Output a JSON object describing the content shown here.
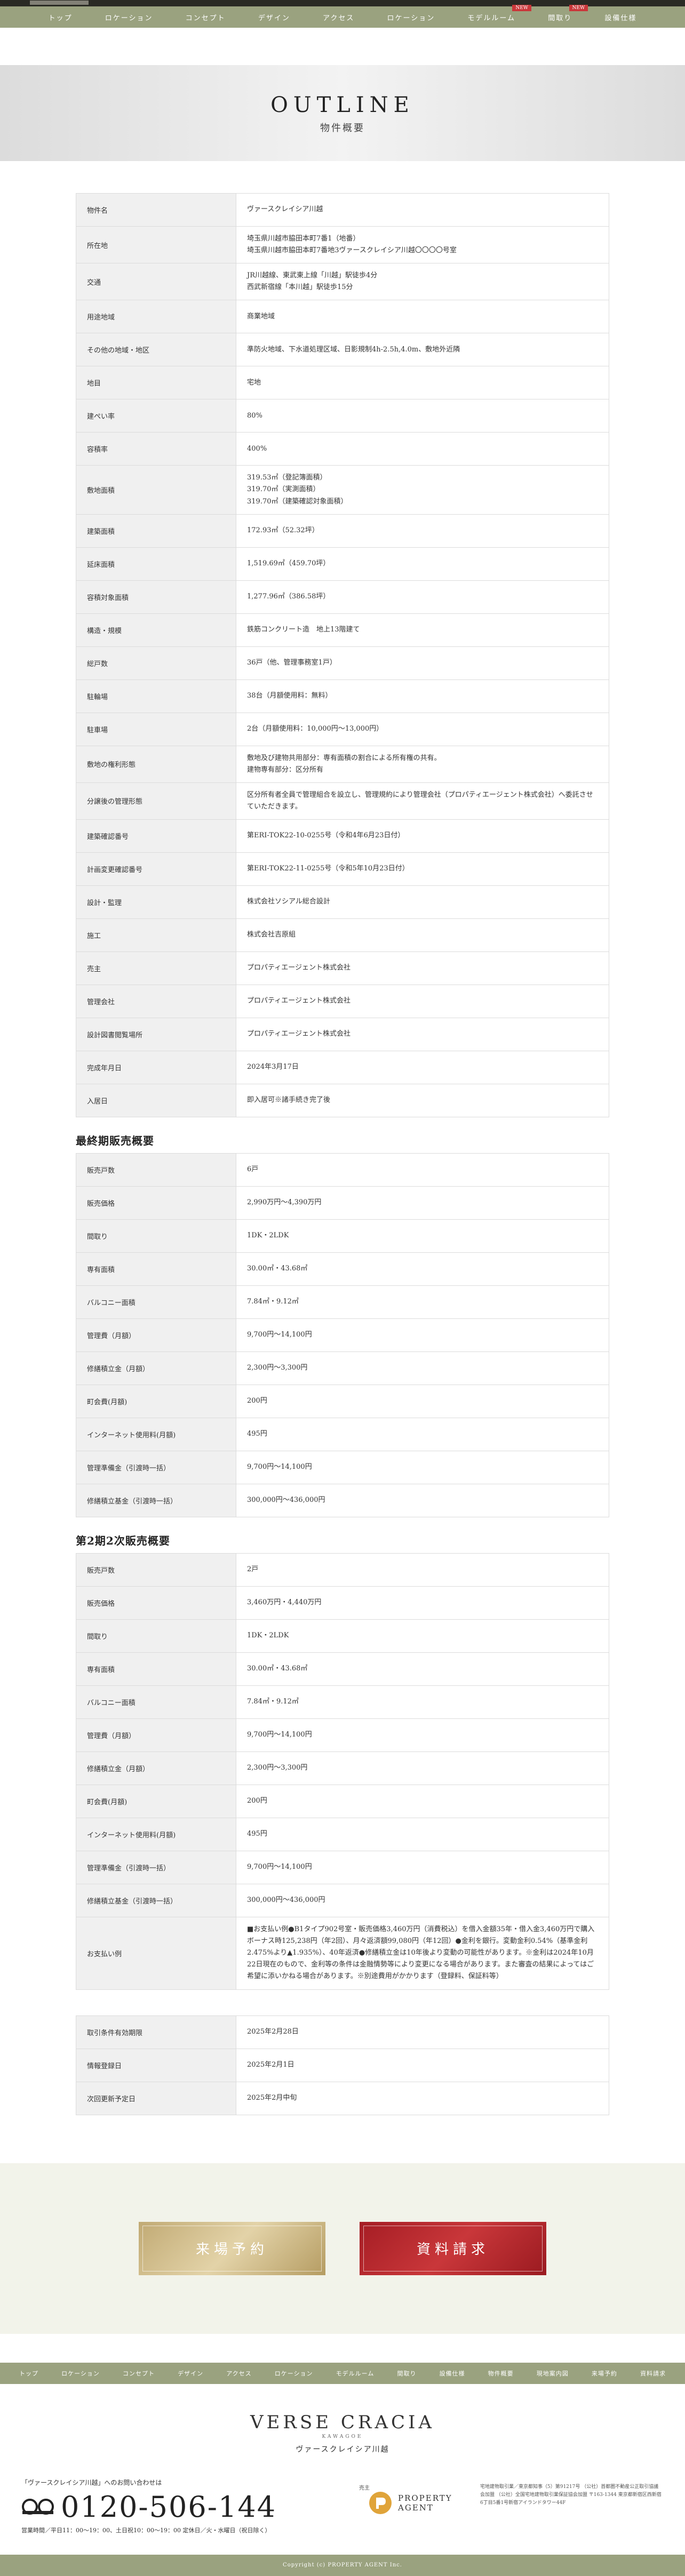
{
  "nav": {
    "items": [
      {
        "label": "トップ",
        "badge": ""
      },
      {
        "label": "ロケーション",
        "badge": ""
      },
      {
        "label": "コンセプト",
        "badge": ""
      },
      {
        "label": "デザイン",
        "badge": ""
      },
      {
        "label": "アクセス",
        "badge": ""
      },
      {
        "label": "ロケーション",
        "badge": ""
      },
      {
        "label": "モデルルーム",
        "badge": "NEW"
      },
      {
        "label": "間取り",
        "badge": "NEW"
      },
      {
        "label": "設備仕様",
        "badge": ""
      }
    ]
  },
  "hero": {
    "title": "OUTLINE",
    "subtitle": "物件概要"
  },
  "outline_rows": [
    {
      "label": "物件名",
      "lines": [
        "ヴァースクレイシア川越"
      ]
    },
    {
      "label": "所在地",
      "lines": [
        "埼玉県川越市脇田本町7番1（地番）",
        "埼玉県川越市脇田本町7番地3ヴァースクレイシア川越〇〇〇〇号室"
      ]
    },
    {
      "label": "交通",
      "lines": [
        "JR川越線、東武東上線「川越」駅徒歩4分",
        "西武新宿線「本川越」駅徒歩15分"
      ]
    },
    {
      "label": "用途地域",
      "lines": [
        "商業地域"
      ]
    },
    {
      "label": "その他の地域・地区",
      "lines": [
        "準防火地域、下水道処理区域、日影規制4h-2.5h,4.0m、敷地外近隣"
      ]
    },
    {
      "label": "地目",
      "lines": [
        "宅地"
      ]
    },
    {
      "label": "建ぺい率",
      "lines": [
        "80%"
      ]
    },
    {
      "label": "容積率",
      "lines": [
        "400%"
      ]
    },
    {
      "label": "敷地面積",
      "lines": [
        "319.53㎡（登記簿面積）",
        "319.70㎡（実測面積）",
        "319.70㎡（建築確認対象面積）"
      ]
    },
    {
      "label": "建築面積",
      "lines": [
        "172.93㎡（52.32坪）"
      ]
    },
    {
      "label": "延床面積",
      "lines": [
        "1,519.69㎡（459.70坪）"
      ]
    },
    {
      "label": "容積対象面積",
      "lines": [
        "1,277.96㎡（386.58坪）"
      ]
    },
    {
      "label": "構造・規模",
      "lines": [
        "鉄筋コンクリート造　地上13階建て"
      ]
    },
    {
      "label": "総戸数",
      "lines": [
        "36戸（他、管理事務室1戸）"
      ]
    },
    {
      "label": "駐輪場",
      "lines": [
        "38台（月額使用料：無料）"
      ]
    },
    {
      "label": "駐車場",
      "lines": [
        "2台（月額使用料：10,000円～13,000円）"
      ]
    },
    {
      "label": "敷地の権利形態",
      "lines": [
        "敷地及び建物共用部分：専有面積の割合による所有権の共有。",
        "建物専有部分：区分所有"
      ]
    },
    {
      "label": "分譲後の管理形態",
      "lines": [
        "区分所有者全員で管理組合を設立し、管理規約により管理会社（プロパティエージェント株式会社）へ委託させていただきます。"
      ]
    },
    {
      "label": "建築確認番号",
      "lines": [
        "第ERI-TOK22-10-0255号（令和4年6月23日付）"
      ]
    },
    {
      "label": "計画変更確認番号",
      "lines": [
        "第ERI-TOK22-11-0255号（令和5年10月23日付）"
      ]
    },
    {
      "label": "設計・監理",
      "lines": [
        "株式会社ソシアル総合設計"
      ]
    },
    {
      "label": "施工",
      "lines": [
        "株式会社吉原組"
      ]
    },
    {
      "label": "売主",
      "lines": [
        "プロパティエージェント株式会社"
      ]
    },
    {
      "label": "管理会社",
      "lines": [
        "プロパティエージェント株式会社"
      ]
    },
    {
      "label": "設計図書閲覧場所",
      "lines": [
        "プロパティエージェント株式会社"
      ]
    },
    {
      "label": "完成年月日",
      "lines": [
        "2024年3月17日"
      ]
    },
    {
      "label": "入居日",
      "lines": [
        "即入居可※諸手続き完了後"
      ]
    }
  ],
  "final_sale": {
    "title": "最終期販売概要",
    "rows": [
      {
        "label": "販売戸数",
        "lines": [
          "6戸"
        ]
      },
      {
        "label": "販売価格",
        "lines": [
          "2,990万円～4,390万円"
        ]
      },
      {
        "label": "間取り",
        "lines": [
          "1DK・2LDK"
        ]
      },
      {
        "label": "専有面積",
        "lines": [
          "30.00㎡・43.68㎡"
        ]
      },
      {
        "label": "バルコニー面積",
        "lines": [
          "7.84㎡・9.12㎡"
        ]
      },
      {
        "label": "管理費（月額）",
        "lines": [
          "9,700円～14,100円"
        ]
      },
      {
        "label": "修繕積立金（月額）",
        "lines": [
          "2,300円～3,300円"
        ]
      },
      {
        "label": "町会費(月額)",
        "lines": [
          "200円"
        ]
      },
      {
        "label": "インターネット使用料(月額)",
        "lines": [
          "495円"
        ]
      },
      {
        "label": "管理準備金（引渡時一括）",
        "lines": [
          "9,700円～14,100円"
        ]
      },
      {
        "label": "修繕積立基金（引渡時一括）",
        "lines": [
          "300,000円～436,000円"
        ]
      }
    ]
  },
  "second_sale": {
    "title": "第2期2次販売概要",
    "rows": [
      {
        "label": "販売戸数",
        "lines": [
          "2戸"
        ]
      },
      {
        "label": "販売価格",
        "lines": [
          "3,460万円・4,440万円"
        ]
      },
      {
        "label": "間取り",
        "lines": [
          "1DK・2LDK"
        ]
      },
      {
        "label": "専有面積",
        "lines": [
          "30.00㎡・43.68㎡"
        ]
      },
      {
        "label": "バルコニー面積",
        "lines": [
          "7.84㎡・9.12㎡"
        ]
      },
      {
        "label": "管理費（月額）",
        "lines": [
          "9,700円～14,100円"
        ]
      },
      {
        "label": "修繕積立金（月額）",
        "lines": [
          "2,300円～3,300円"
        ]
      },
      {
        "label": "町会費(月額)",
        "lines": [
          "200円"
        ]
      },
      {
        "label": "インターネット使用料(月額)",
        "lines": [
          "495円"
        ]
      },
      {
        "label": "管理準備金（引渡時一括）",
        "lines": [
          "9,700円～14,100円"
        ]
      },
      {
        "label": "修繕積立基金（引渡時一括）",
        "lines": [
          "300,000円～436,000円"
        ]
      },
      {
        "label": "お支払い例",
        "lines": [
          "■お支払い例●B1タイプ902号室・販売価格3,460万円（消費税込）を借入金額35年・借入金3,460万円で購入 ボーナス時125,238円（年2回）、月々返済額99,080円（年12回）●金利を銀行。変動金利0.54%（基準金利2.475%より▲1.935%）、40年返済●修繕積立金は10年後より変動の可能性があります。※金利は2024年10月22日現在のもので、金利等の条件は金融情勢等により変更になる場合があります。また審査の結果によってはご希望に添いかねる場合があります。※別途費用がかかります（登録料、保証料等）"
        ]
      }
    ]
  },
  "info_rows": [
    {
      "label": "取引条件有効期限",
      "lines": [
        "2025年2月28日"
      ]
    },
    {
      "label": "情報登録日",
      "lines": [
        "2025年2月1日"
      ]
    },
    {
      "label": "次回更新予定日",
      "lines": [
        "2025年2月中旬"
      ]
    }
  ],
  "cta": {
    "reserve_label": "来場予約",
    "request_label": "資料請求"
  },
  "footer_nav": [
    "トップ",
    "ロケーション",
    "コンセプト",
    "デザイン",
    "アクセス",
    "ロケーション",
    "モデルルーム",
    "間取り",
    "設備仕様",
    "物件概要",
    "現地案内図",
    "来場予約",
    "資料請求"
  ],
  "footer": {
    "brand": "VERSE CRACIA",
    "kana": "KAWAGOE",
    "name_jp": "ヴァースクレイシア川越",
    "lead": "「ヴァースクレイシア川越」へのお問い合わせは",
    "tel": "0120-506-144",
    "hours": "営業時間／平日11：00～19：00、土日祝10：00～19：00 定休日／火・水曜日（祝日除く）",
    "seller_role": "売主",
    "agent_name_1": "PROPERTY",
    "agent_name_2": "AGENT",
    "company": "宅地建物取引業／東京都知事（5）第91217号 （公社）首都圏不動産公正取引協議会加盟 （公社）全国宅地建物取引業保証協会加盟 〒163-1344 東京都新宿区西新宿6丁目5番1号新宿アイランドタワー44F"
  },
  "copyright": "Copyright (c) PROPERTY AGENT Inc."
}
